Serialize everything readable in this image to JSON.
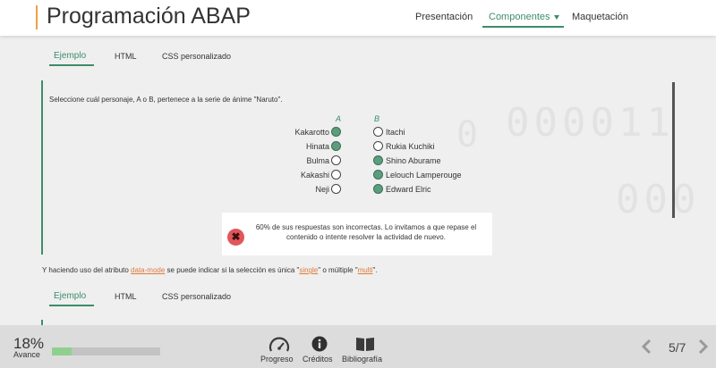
{
  "header": {
    "title": "Programación ABAP",
    "nav": [
      "Presentación",
      "Componentes",
      "Maquetación"
    ],
    "active_nav": "Componentes"
  },
  "tabs": [
    "Ejemplo",
    "HTML",
    "CSS personalizado"
  ],
  "exercise": {
    "question": "Seleccione cuál personaje, A o B, pertenece a la serie de ánime \"Naruto\".",
    "col_a": "A",
    "col_b": "B",
    "rows": [
      {
        "a": "Kakarotto",
        "a_checked": true,
        "b": "Itachi",
        "b_checked": false
      },
      {
        "a": "Hinata",
        "a_checked": true,
        "b": "Rukia Kuchiki",
        "b_checked": false
      },
      {
        "a": "Bulma",
        "a_checked": false,
        "b": "Shino Aburame",
        "b_checked": true
      },
      {
        "a": "Kakashi",
        "a_checked": false,
        "b": "Lelouch Lamperouge",
        "b_checked": true
      },
      {
        "a": "Neji",
        "a_checked": false,
        "b": "Edward Elric",
        "b_checked": true
      }
    ],
    "feedback": "60% de sus respuestas son incorrectas. Lo invitamos a que repase el contenido o intente resolver la actividad de nuevo.",
    "feedback_icon": "close-icon"
  },
  "explanation": {
    "part1": "Y haciendo uso del atributo ",
    "code1": "data-mode",
    "part2": " se puede indicar si la selección es única \"",
    "code2": "single",
    "part3": "\" o múltiple \"",
    "code3": "multi",
    "part4": "\"."
  },
  "footer": {
    "percent_text": "18%",
    "percent_label": "Avance",
    "progress": 0.18,
    "items": [
      {
        "label": "Progreso",
        "icon": "gauge-icon"
      },
      {
        "label": "Créditos",
        "icon": "info-icon"
      },
      {
        "label": "Bibliografía",
        "icon": "book-icon"
      }
    ],
    "page": "5/7"
  },
  "colors": {
    "accent": "#3c8d6a",
    "title_bar": "#f0a040",
    "error": "#e0565b",
    "progress": "#8fd08f",
    "code": "#e07a3c"
  }
}
